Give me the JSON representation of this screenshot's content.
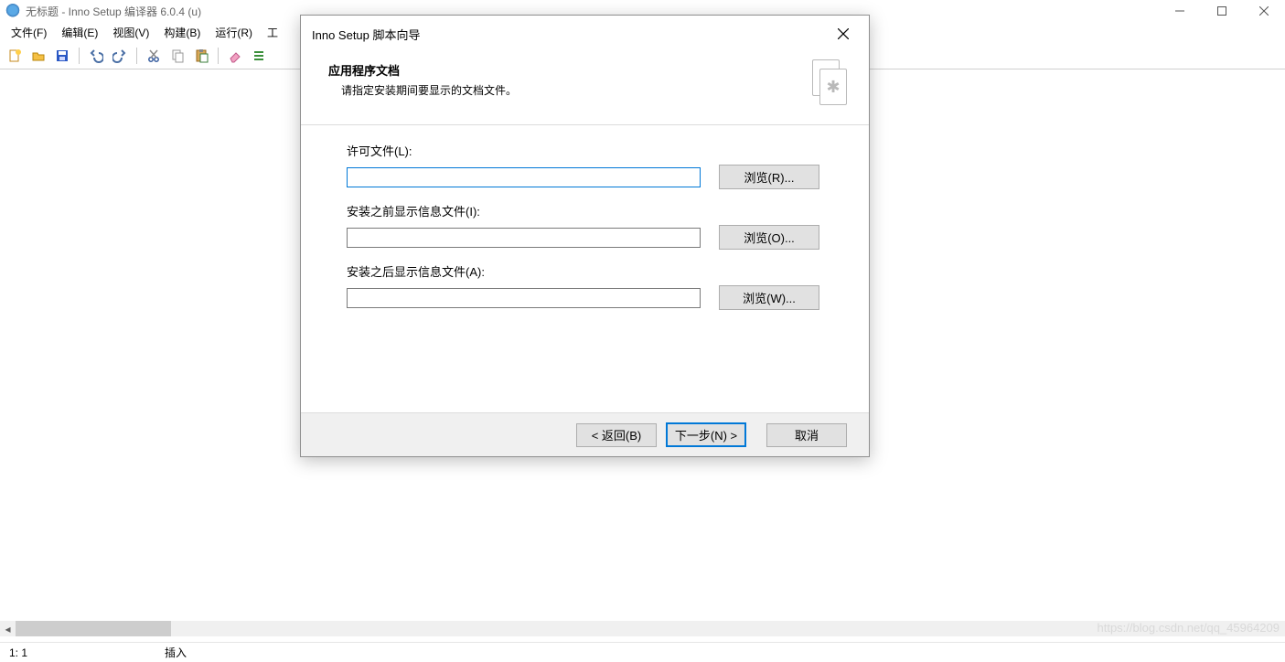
{
  "window": {
    "title": "无标题 - Inno Setup 编译器 6.0.4 (u)"
  },
  "menu": {
    "file": "文件(F)",
    "edit": "编辑(E)",
    "view": "视图(V)",
    "build": "构建(B)",
    "run": "运行(R)",
    "tools_cut": "工"
  },
  "status": {
    "cursor": "1:   1",
    "mode": "插入"
  },
  "watermark": "https://blog.csdn.net/qq_45964209",
  "dialog": {
    "title": "Inno Setup 脚本向导",
    "heading": "应用程序文档",
    "subheading": "请指定安装期间要显示的文档文件。",
    "license_label": "许可文件(L):",
    "license_value": "",
    "infobefore_label": "安装之前显示信息文件(I):",
    "infobefore_value": "",
    "infoafter_label": "安装之后显示信息文件(A):",
    "infoafter_value": "",
    "browse_r": "浏览(R)...",
    "browse_o": "浏览(O)...",
    "browse_w": "浏览(W)...",
    "back": "< 返回(B)",
    "next": "下一步(N) >",
    "cancel": "取消"
  }
}
